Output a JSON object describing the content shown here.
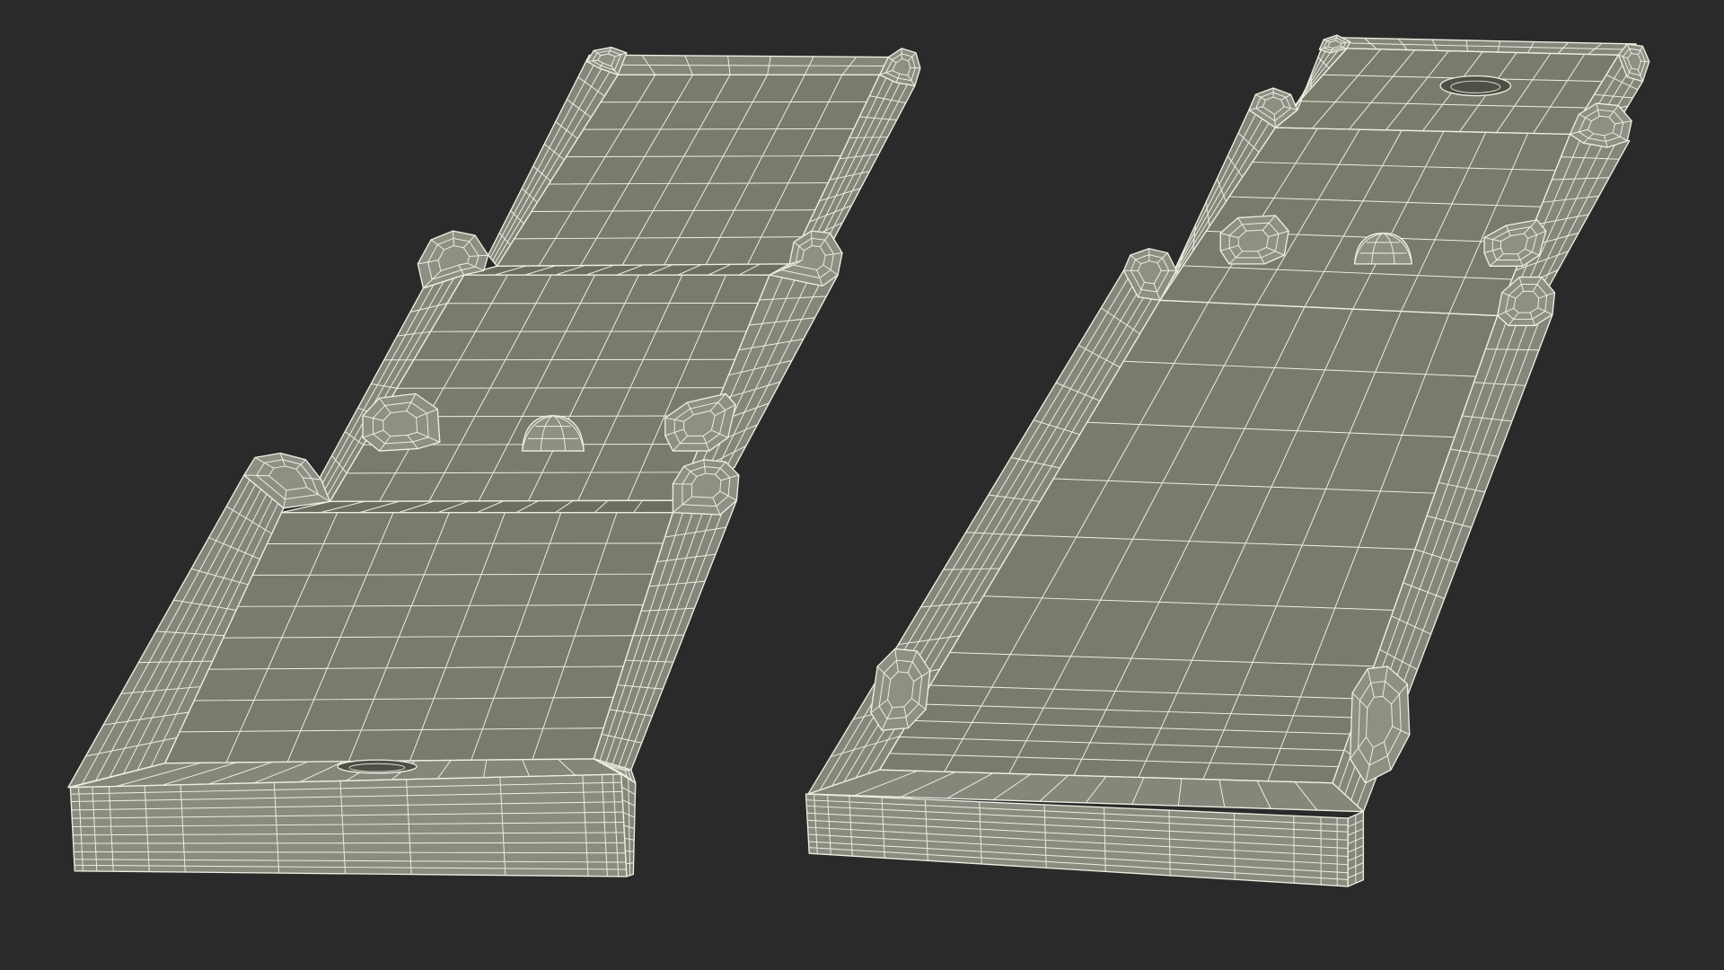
{
  "colors": {
    "background": "#2a2a2a",
    "floor": "#7a7b6c",
    "step": "#6c6e60",
    "rail": "#85877a",
    "rail_highlight": "#8e9083",
    "wall_face": "#8a8c7f",
    "hole": "#4e5045",
    "wire": "#efeee3"
  }
}
